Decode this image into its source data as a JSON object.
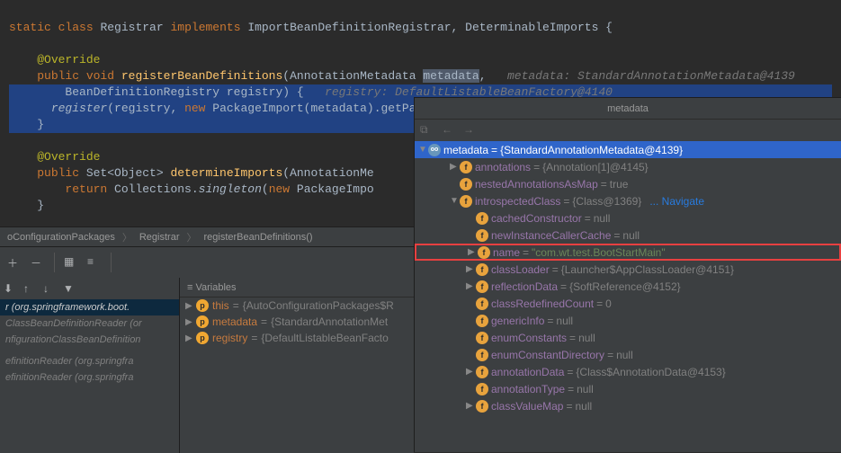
{
  "code": {
    "line1": {
      "static": "static",
      "class": "class",
      "Registrar": "Registrar",
      "implements": "implements",
      "rest": "ImportBeanDefinitionRegistrar, DeterminableImports {"
    },
    "override": "@Override",
    "sig1_a": "public void",
    "sig1_b": "registerBeanDefinitions",
    "sig1_c": "(AnnotationMetadata ",
    "sig1_meta": "metadata",
    "sig1_d": ",",
    "sig1_hint": "   metadata: StandardAnnotationMetadata@4139",
    "line4": "BeanDefinitionRegistry registry) {",
    "line4_hint": "   registry: DefaultListableBeanFactory@4140",
    "line5a": "register",
    "line5b": "(registry, ",
    "line5new": "new",
    "line5c": " PackageImport(metadata).getPackageName());",
    "line5_hint": "   registry: DefaultListableBeanFactory@4140",
    "line6": "}",
    "sig2_a": "public",
    "sig2_b": " Set<Object> ",
    "sig2_c": "determineImports",
    "sig2_d": "(AnnotationMe",
    "line9a": "return",
    "line9b": " Collections.",
    "line9c": "singleton",
    "line9d": "(",
    "line9e": "new",
    "line9f": " PackageImpo",
    "line10": "}",
    "line12": "}"
  },
  "breadcrumb": {
    "a": "oConfigurationPackages",
    "b": "Registrar",
    "c": "registerBeanDefinitions()"
  },
  "vars_header": "≡ Variables",
  "vars": [
    {
      "badge": "p",
      "name": "this",
      "val": "{AutoConfigurationPackages$R"
    },
    {
      "badge": "p",
      "name": "metadata",
      "val": "{StandardAnnotationMet"
    },
    {
      "badge": "p",
      "name": "registry",
      "val": "{DefaultListableBeanFacto"
    }
  ],
  "frames": [
    {
      "sel": true,
      "text": "r (org.springframework.boot."
    },
    {
      "sel": false,
      "text": "ClassBeanDefinitionReader (or"
    },
    {
      "sel": false,
      "text": "nfigurationClassBeanDefinition"
    },
    {
      "sel": false,
      "text": ""
    },
    {
      "sel": false,
      "text": "efinitionReader (org.springfra"
    },
    {
      "sel": false,
      "text": "efinitionReader (org.springfra"
    }
  ],
  "md": {
    "title": "metadata",
    "root": {
      "name": "metadata",
      "val": "{StandardAnnotationMetadata@4139}"
    },
    "rows": [
      {
        "depth": 1,
        "arrow": "▶",
        "badge": "f",
        "name": "annotations",
        "val": "{Annotation[1]@4145}"
      },
      {
        "depth": 1,
        "arrow": "",
        "badge": "f",
        "name": "nestedAnnotationsAsMap",
        "val": "true"
      },
      {
        "depth": 1,
        "arrow": "▼",
        "badge": "f",
        "name": "introspectedClass",
        "val": "{Class@1369}",
        "link": "... Navigate"
      },
      {
        "depth": 2,
        "arrow": "",
        "badge": "f",
        "name": "cachedConstructor",
        "val": "null"
      },
      {
        "depth": 2,
        "arrow": "",
        "badge": "f",
        "name": "newInstanceCallerCache",
        "val": "null"
      },
      {
        "depth": 2,
        "arrow": "▶",
        "badge": "f",
        "name": "name",
        "strval": "\"com.wt.test.BootStartMain\"",
        "hl": true
      },
      {
        "depth": 2,
        "arrow": "▶",
        "badge": "f",
        "name": "classLoader",
        "val": "{Launcher$AppClassLoader@4151}"
      },
      {
        "depth": 2,
        "arrow": "▶",
        "badge": "f",
        "name": "reflectionData",
        "val": "{SoftReference@4152}"
      },
      {
        "depth": 2,
        "arrow": "",
        "badge": "f",
        "name": "classRedefinedCount",
        "val": "0"
      },
      {
        "depth": 2,
        "arrow": "",
        "badge": "f",
        "name": "genericInfo",
        "val": "null"
      },
      {
        "depth": 2,
        "arrow": "",
        "badge": "f",
        "name": "enumConstants",
        "val": "null"
      },
      {
        "depth": 2,
        "arrow": "",
        "badge": "f",
        "name": "enumConstantDirectory",
        "val": "null"
      },
      {
        "depth": 2,
        "arrow": "▶",
        "badge": "f",
        "name": "annotationData",
        "val": "{Class$AnnotationData@4153}"
      },
      {
        "depth": 2,
        "arrow": "",
        "badge": "f",
        "name": "annotationType",
        "val": "null"
      },
      {
        "depth": 2,
        "arrow": "▶",
        "badge": "f",
        "name": "classValueMap",
        "val": "null"
      }
    ]
  }
}
